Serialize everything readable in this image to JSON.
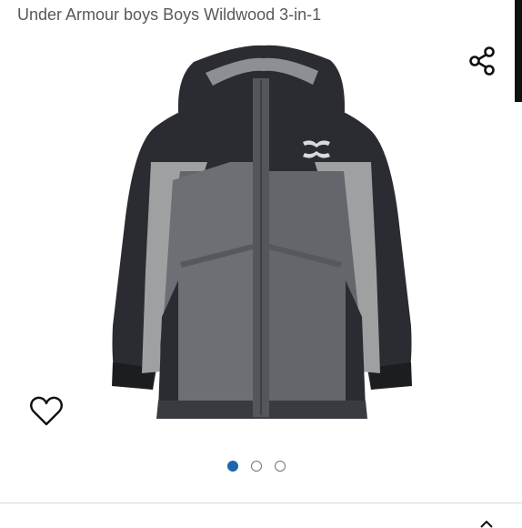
{
  "product": {
    "title": "Under Armour boys Boys Wildwood 3-in-1",
    "image_alt": "Under Armour boys Boys Wildwood 3-in-1 jacket image"
  },
  "actions": {
    "share_icon": "share-icon",
    "wishlist_icon": "heart-icon"
  },
  "carousel": {
    "total": 3,
    "active_index": 0,
    "colors": {
      "active": "#1e64b0",
      "inactive": "#ffffff"
    }
  }
}
